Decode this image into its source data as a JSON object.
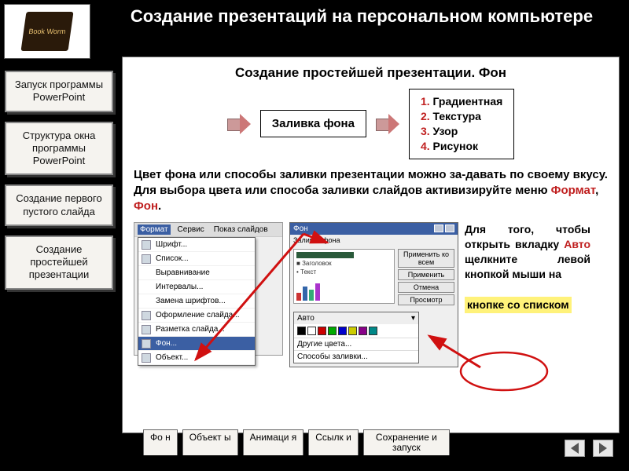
{
  "title": "Создание презентаций на персональном компьютере",
  "logo_text": "Book Worm",
  "sidebar": {
    "items": [
      {
        "label": "Запуск программы PowerPoint"
      },
      {
        "label": "Структура окна программы PowerPoint"
      },
      {
        "label": "Создание первого пустого слайда"
      },
      {
        "label": "Создание простейшей презентации"
      }
    ]
  },
  "content": {
    "heading": "Создание простейшей презентации. Фон",
    "flow_box": "Заливка фона",
    "fill_options": [
      "Градиентная",
      "Текстура",
      "Узор",
      "Рисунок"
    ],
    "para_pre": "Цвет фона или способы заливки презентации можно за-давать по своему вкусу. Для выбора цвета или способа заливки слайдов активизируйте меню ",
    "para_red1": "Формат",
    "para_sep": ", ",
    "para_red2": "Фон",
    "para_end": ".",
    "side_pre": "Для того, чтобы открыть вкладку ",
    "side_red": "Авто",
    "side_mid": " щелкните левой кнопкой мыши на",
    "side_highlight": "кнопке со списком"
  },
  "mock_menu": {
    "tabs": [
      "Формат",
      "Сервис",
      "Показ слайдов"
    ],
    "items": [
      "Шрифт...",
      "Список...",
      "Выравнивание",
      "Интервалы...",
      "Замена шрифтов...",
      "Оформление слайда...",
      "Разметка слайда...",
      "Фон...",
      "Объект..."
    ]
  },
  "mock_dialog": {
    "title": "Фон",
    "section": "Заливка фона",
    "preview_title": "Заголовок",
    "preview_text": "Текст",
    "buttons": [
      "Применить ко всем",
      "Применить",
      "Отмена",
      "Просмотр"
    ],
    "dropdown_label": "Авто",
    "extra": [
      "Другие цвета...",
      "Способы заливки..."
    ],
    "swatches": [
      "#000",
      "#fff",
      "#c00",
      "#0a0",
      "#00c",
      "#cc0",
      "#808",
      "#088"
    ]
  },
  "bottom_tabs": [
    "Фо н",
    "Объект ы",
    "Анимаци я",
    "Ссылк и",
    "Сохранение и запуск"
  ]
}
